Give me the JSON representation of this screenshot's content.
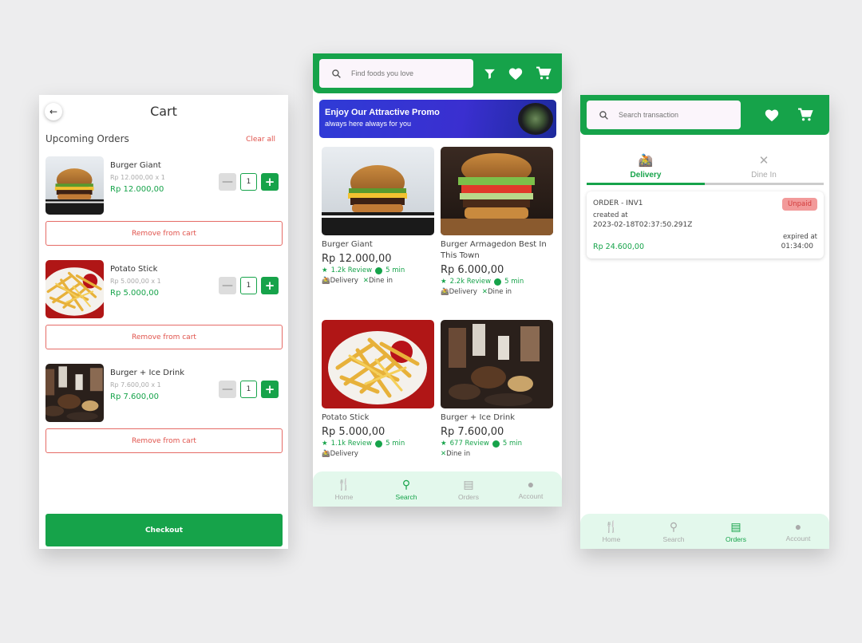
{
  "cart": {
    "title": "Cart",
    "section_title": "Upcoming Orders",
    "clear_all": "Clear all",
    "items": [
      {
        "name": "Burger Giant",
        "unit": "Rp 12.000,00 x 1",
        "total": "Rp 12.000,00",
        "qty": "1",
        "remove": "Remove from cart"
      },
      {
        "name": "Potato Stick",
        "unit": "Rp 5.000,00 x 1",
        "total": "Rp 5.000,00",
        "qty": "1",
        "remove": "Remove from cart"
      },
      {
        "name": "Burger + Ice Drink",
        "unit": "Rp 7.600,00 x 1",
        "total": "Rp 7.600,00",
        "qty": "1",
        "remove": "Remove from cart"
      }
    ],
    "checkout": "Checkout"
  },
  "search": {
    "placeholder": "Find foods you love",
    "promo_title": "Enjoy Our Attractive Promo",
    "promo_sub": "always here always for you",
    "foods": [
      {
        "name": "Burger Giant",
        "price": "Rp 12.000,00",
        "review": "1.2k Review",
        "time": "5 min",
        "delivery": "Delivery",
        "dine": "Dine in"
      },
      {
        "name": "Burger Armagedon Best In This Town",
        "price": "Rp 6.000,00",
        "review": "2.2k Review",
        "time": "5 min",
        "delivery": "Delivery",
        "dine": "Dine in"
      },
      {
        "name": "Potato Stick",
        "price": "Rp 5.000,00",
        "review": "1.1k Review",
        "time": "5 min",
        "delivery": "Delivery"
      },
      {
        "name": "Burger + Ice Drink",
        "price": "Rp 7.600,00",
        "review": "677 Review",
        "time": "5 min",
        "dine": "Dine in"
      }
    ]
  },
  "nav": {
    "home": "Home",
    "search": "Search",
    "orders": "Orders",
    "account": "Account"
  },
  "orders": {
    "placeholder": "Search transaction",
    "tab_delivery": "Delivery",
    "tab_dinein": "Dine In",
    "card": {
      "id": "ORDER - INV1",
      "created_label": "created at",
      "created": "2023-02-18T02:37:50.291Z",
      "status": "Unpaid",
      "amount": "Rp 24.600,00",
      "expired_label": "expired at",
      "expired": "01:34:00"
    }
  },
  "colors": {
    "primary": "#16a34a",
    "danger": "#e0524b",
    "nav_bg": "#e3f8ec"
  }
}
